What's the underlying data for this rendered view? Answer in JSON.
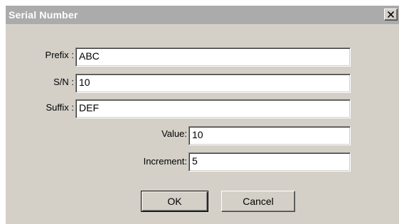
{
  "window": {
    "title": "Serial Number",
    "close_icon": "close-icon"
  },
  "form": {
    "prefix_label": "Prefix :",
    "prefix_value": "ABC",
    "sn_label": "S/N :",
    "sn_value": "10",
    "suffix_label": "Suffix :",
    "suffix_value": "DEF",
    "value_label": "Value:",
    "value_value": "10",
    "increment_label": "Increment:",
    "increment_value": "5"
  },
  "buttons": {
    "ok_label": "OK",
    "cancel_label": "Cancel"
  }
}
